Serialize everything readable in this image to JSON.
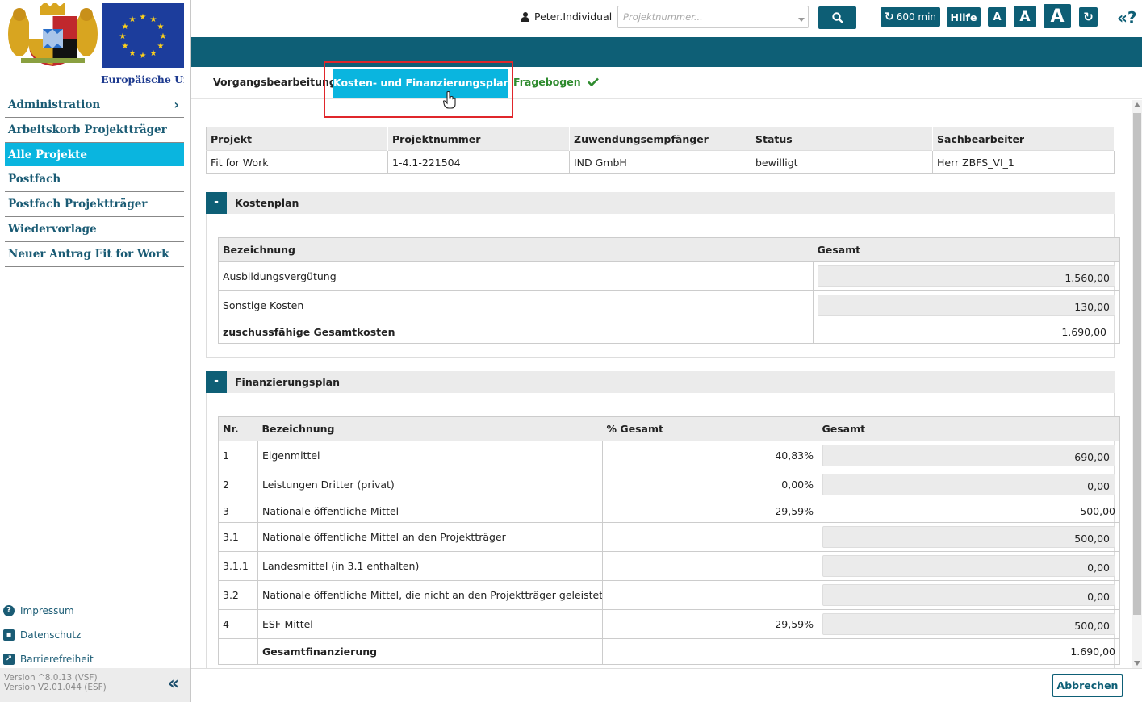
{
  "sidebar": {
    "eu_label": "Europäische Union",
    "nav": [
      {
        "label": "Administration",
        "has_chevron": true,
        "active": false
      },
      {
        "label": "Arbeitskorb Projektträger",
        "active": false
      },
      {
        "label": "Alle Projekte",
        "active": true
      },
      {
        "label": "Postfach",
        "active": false
      },
      {
        "label": "Postfach Projektträger",
        "active": false
      },
      {
        "label": "Wiedervorlage",
        "active": false
      },
      {
        "label": "Neuer Antrag Fit for Work",
        "active": false
      }
    ],
    "footer_links": [
      {
        "label": "Impressum",
        "icon": "help-circle-icon"
      },
      {
        "label": "Datenschutz",
        "icon": "contact-card-icon"
      },
      {
        "label": "Barrierefreiheit",
        "icon": "external-edit-icon"
      }
    ],
    "version_line1": "Version ^8.0.13 (VSF)",
    "version_line2": "Version V2.01.044 (ESF)",
    "collapse_glyph": "«"
  },
  "topbar": {
    "user": "Peter.Individual",
    "project_search_placeholder": "Projektnummer...",
    "session_timer": "600 min",
    "help_label": "Hilfe",
    "font_size_small": "A",
    "font_size_medium": "A",
    "font_size_large": "A",
    "help_icon_glyph": "«?"
  },
  "tabs": [
    {
      "label": "Vorgangsbearbeitung",
      "active": false
    },
    {
      "label": "Kosten- und Finanzierungsplan",
      "active": true
    },
    {
      "label": "Fragebogen",
      "completed": true
    }
  ],
  "project_info": {
    "headers": [
      "Projekt",
      "Projektnummer",
      "Zuwendungsempfänger",
      "Status",
      "Sachbearbeiter"
    ],
    "values": [
      "Fit for Work",
      "1-4.1-221504",
      "IND GmbH",
      "bewilligt",
      "Herr ZBFS_VI_1"
    ]
  },
  "kostenplan": {
    "title": "Kostenplan",
    "toggle": "-",
    "headers": [
      "Bezeichnung",
      "Gesamt"
    ],
    "rows": [
      {
        "label": "Ausbildungsvergütung",
        "amount": "1.560,00"
      },
      {
        "label": "Sonstige Kosten",
        "amount": "130,00"
      }
    ],
    "total": {
      "label": "zuschussfähige Gesamtkosten",
      "amount": "1.690,00"
    }
  },
  "finanzierungsplan": {
    "title": "Finanzierungsplan",
    "toggle": "-",
    "headers": [
      "Nr.",
      "Bezeichnung",
      "% Gesamt",
      "Gesamt"
    ],
    "rows": [
      {
        "nr": "1",
        "label": "Eigenmittel",
        "percent": "40,83%",
        "amount": "690,00",
        "boxed": true
      },
      {
        "nr": "2",
        "label": "Leistungen Dritter (privat)",
        "percent": "0,00%",
        "amount": "0,00",
        "boxed": true
      },
      {
        "nr": "3",
        "label": "Nationale öffentliche Mittel",
        "percent": "29,59%",
        "amount": "500,00",
        "boxed": false
      },
      {
        "nr": "3.1",
        "label": "Nationale öffentliche Mittel an den Projektträger",
        "percent": "",
        "amount": "500,00",
        "boxed": true
      },
      {
        "nr": "3.1.1",
        "label": "Landesmittel (in 3.1 enthalten)",
        "percent": "",
        "amount": "0,00",
        "boxed": true
      },
      {
        "nr": "3.2",
        "label": "Nationale öffentliche Mittel, die nicht an den Projektträger geleistet werden",
        "percent": "",
        "amount": "0,00",
        "boxed": true
      },
      {
        "nr": "4",
        "label": "ESF-Mittel",
        "percent": "29,59%",
        "amount": "500,00",
        "boxed": true
      }
    ],
    "total": {
      "nr": "",
      "label": "Gesamtfinanzierung",
      "percent": "",
      "amount": "1.690,00"
    }
  },
  "footer": {
    "cancel_label": "Abbrechen"
  },
  "colors": {
    "teal": "#0e5f76",
    "active_blue": "#0ab5df",
    "highlight_red": "#e0262b",
    "success_green": "#2e8b2e"
  }
}
